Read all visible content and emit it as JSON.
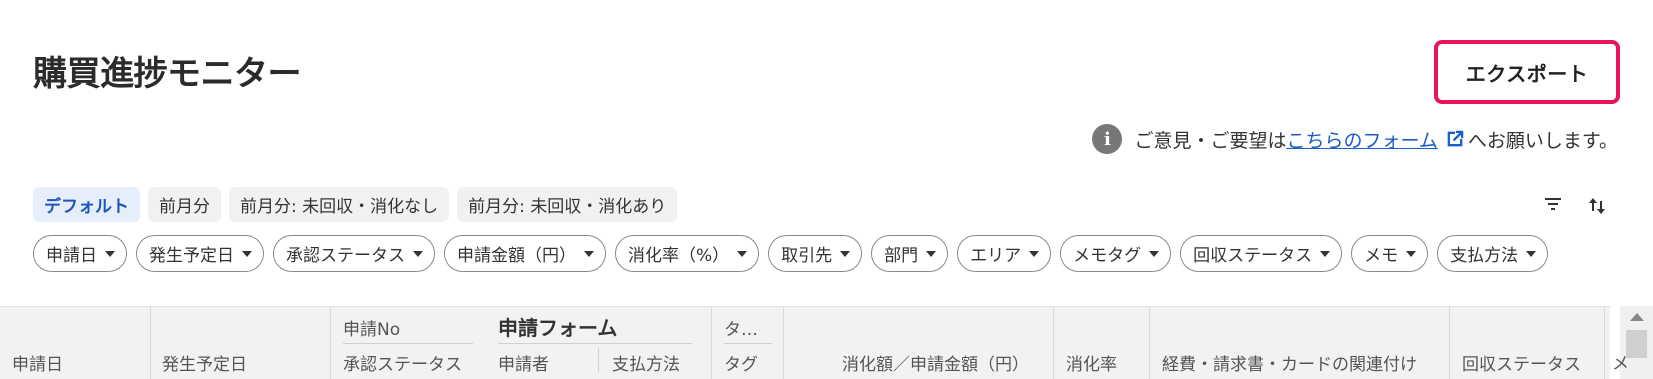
{
  "header": {
    "title": "購買進捗モニター",
    "export_label": "エクスポート"
  },
  "feedback": {
    "info_icon": "i",
    "prefix": "ご意見・ご要望は",
    "link": "こちらのフォーム",
    "suffix": "へお願いします。"
  },
  "views": [
    {
      "label": "デフォルト",
      "active": true
    },
    {
      "label": "前月分"
    },
    {
      "label": "前月分: 未回収・消化なし"
    },
    {
      "label": "前月分: 未回収・消化あり"
    }
  ],
  "filters": [
    "申請日",
    "発生予定日",
    "承認ステータス",
    "申請金額（円）",
    "消化率（%）",
    "取引先",
    "部門",
    "エリア",
    "メモタグ",
    "回収ステータス",
    "メモ",
    "支払方法"
  ],
  "table": {
    "col_apply_date": "申請日",
    "col_due_date": "発生予定日",
    "col_apply_no": "申請No",
    "col_approval_status": "承認ステータス",
    "form_title": "申請フォーム",
    "col_applicant": "申請者",
    "col_payment_method": "支払方法",
    "col_ta_truncated": "タ…",
    "col_tag": "タグ",
    "col_consumed_amount": "消化額／申請金額（円）",
    "col_consumption_rate": "消化率",
    "col_linkage": "経費・請求書・カードの関連付け",
    "col_collection_status": "回収ステータス",
    "col_memo_partial": "メ"
  },
  "colors": {
    "accent": "#e8145f",
    "link": "#1a5dc8",
    "active_chip_bg": "#e6eefb",
    "active_chip_text": "#1d56b9"
  }
}
